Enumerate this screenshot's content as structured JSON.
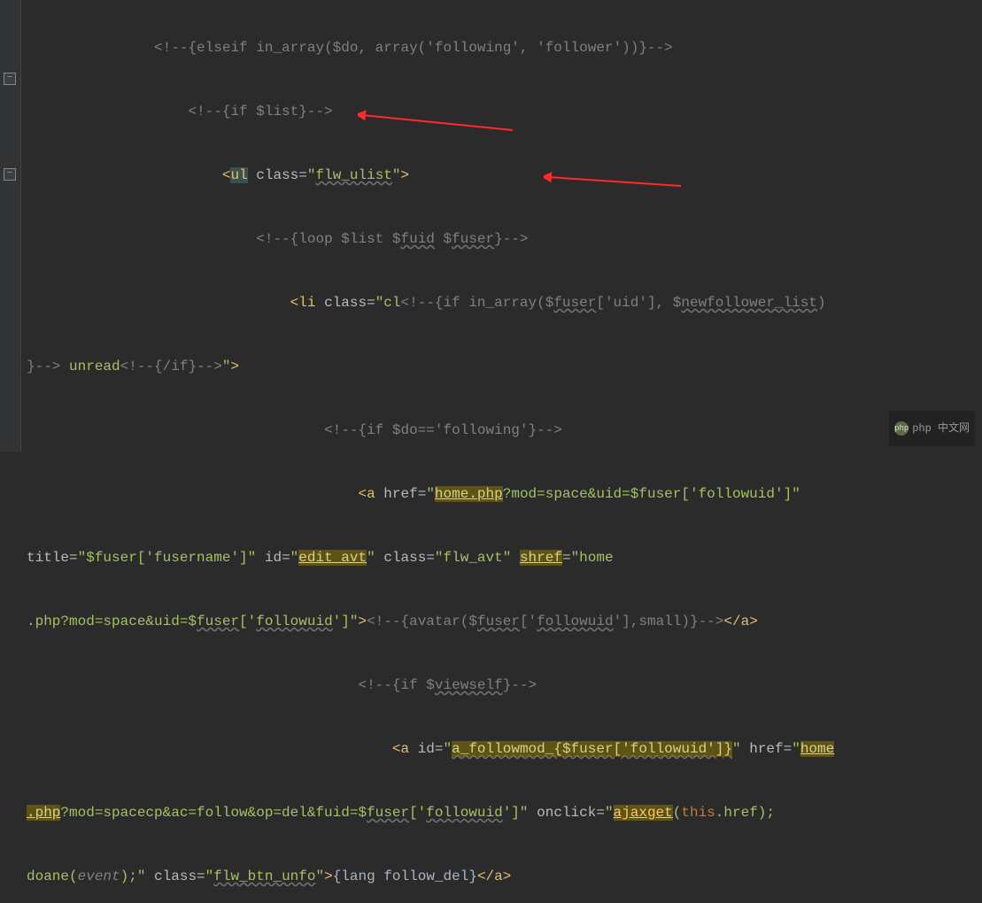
{
  "watermark": "php 中文网",
  "code": {
    "l1_cmt": "<!--{elseif in_array($do, array('following', 'follower'))}-->",
    "l2_cmt": "<!--{if $list}-->",
    "l3_tag_open": "<",
    "l3_tag_name": "ul",
    "l3_attr_class": "class=",
    "l3_class_quote": "\"",
    "l3_class_val": "flw_ulist",
    "l3_tag_close": ">",
    "l4_cmt_a": "<!--{loop $list $",
    "l4_fuid": "fuid",
    "l4_sp": " $",
    "l4_fuser": "fuser",
    "l4_cmt_b": "}-->",
    "l5_tag_open": "<",
    "l5_tag_name": "li",
    "l5_attr_class": "class=",
    "l5_q": "\"",
    "l5_cl": "cl",
    "l5_cmt_a": "<!--{if in_array($",
    "l5_fuser": "fuser",
    "l5_bracket": "['uid'], $",
    "l5_newf": "newfollower_list",
    "l5_paren": ")",
    "l6_cmt_a": "}--> ",
    "l6_unread": "unread",
    "l6_cmt_b": "<!--{/if}-->",
    "l6_close": "\">",
    "l7_cmt": "<!--{if $do=='following'}-->",
    "l8_tag_open": "<",
    "l8_a": "a",
    "l8_href": "href=",
    "l8_q": "\"",
    "l8_home": "home.php",
    "l8_query": "?mod=space&uid=$fuser['followuid']\"",
    "l9_title": "title=",
    "l9_titlev": "\"$fuser['fusername']\"",
    "l9_id": "id=",
    "l9_idv": "\"",
    "l9_editavt": "edit_avt",
    "l9_q2": "\"",
    "l9_class": "class=",
    "l9_classv": "\"flw_avt\"",
    "l9_shref": "shref",
    "l9_eq": "=",
    "l9_shrefv": "\"home",
    "l10_a": ".php?mod=space&uid=$",
    "l10_fuser": "fuser",
    "l10_b": "['",
    "l10_followuid": "followuid",
    "l10_c": "']\"",
    "l10_close": ">",
    "l10_cmt_a": "<!--{avatar($",
    "l10_fuser2": "fuser",
    "l10_d": "['",
    "l10_followuid2": "followuid",
    "l10_e": "'],small)}-->",
    "l10_endtag": "</",
    "l10_a2": "a",
    "l10_endtag2": ">",
    "l11_cmt_a": "<!--{if $",
    "l11_viewself": "viewself",
    "l11_cmt_b": "}-->",
    "l12_tag_open": "<",
    "l12_a": "a",
    "l12_id": "id=",
    "l12_q": "\"",
    "l12_idv": "a_followmod_{$fuser['followuid']}",
    "l12_q2": "\"",
    "l12_href": "href=",
    "l12_q3": "\"",
    "l12_home": "home",
    "l13_a": ".php",
    "l13_query": "?mod=spacecp&ac=follow&op=del&fuid=$",
    "l13_fuser": "fuser",
    "l13_b": "['",
    "l13_followuid": "followuid",
    "l13_c": "']\"",
    "l13_onclick": "onclick=",
    "l13_q": "\"",
    "l13_ajaxget": "ajaxget",
    "l13_paren": "(",
    "l13_this": "this",
    "l13_href2": ".href);",
    "l14_doane": "doane(",
    "l14_event": "event",
    "l14_close": ");\"",
    "l14_class": "class=",
    "l14_q": "\"",
    "l14_classv": "flw_btn_unfo",
    "l14_q2": "\"",
    "l14_gt": ">",
    "l14_lang": "{lang follow_del}",
    "l14_endtag": "</",
    "l14_a": "a",
    "l14_endtag2": ">"
  }
}
